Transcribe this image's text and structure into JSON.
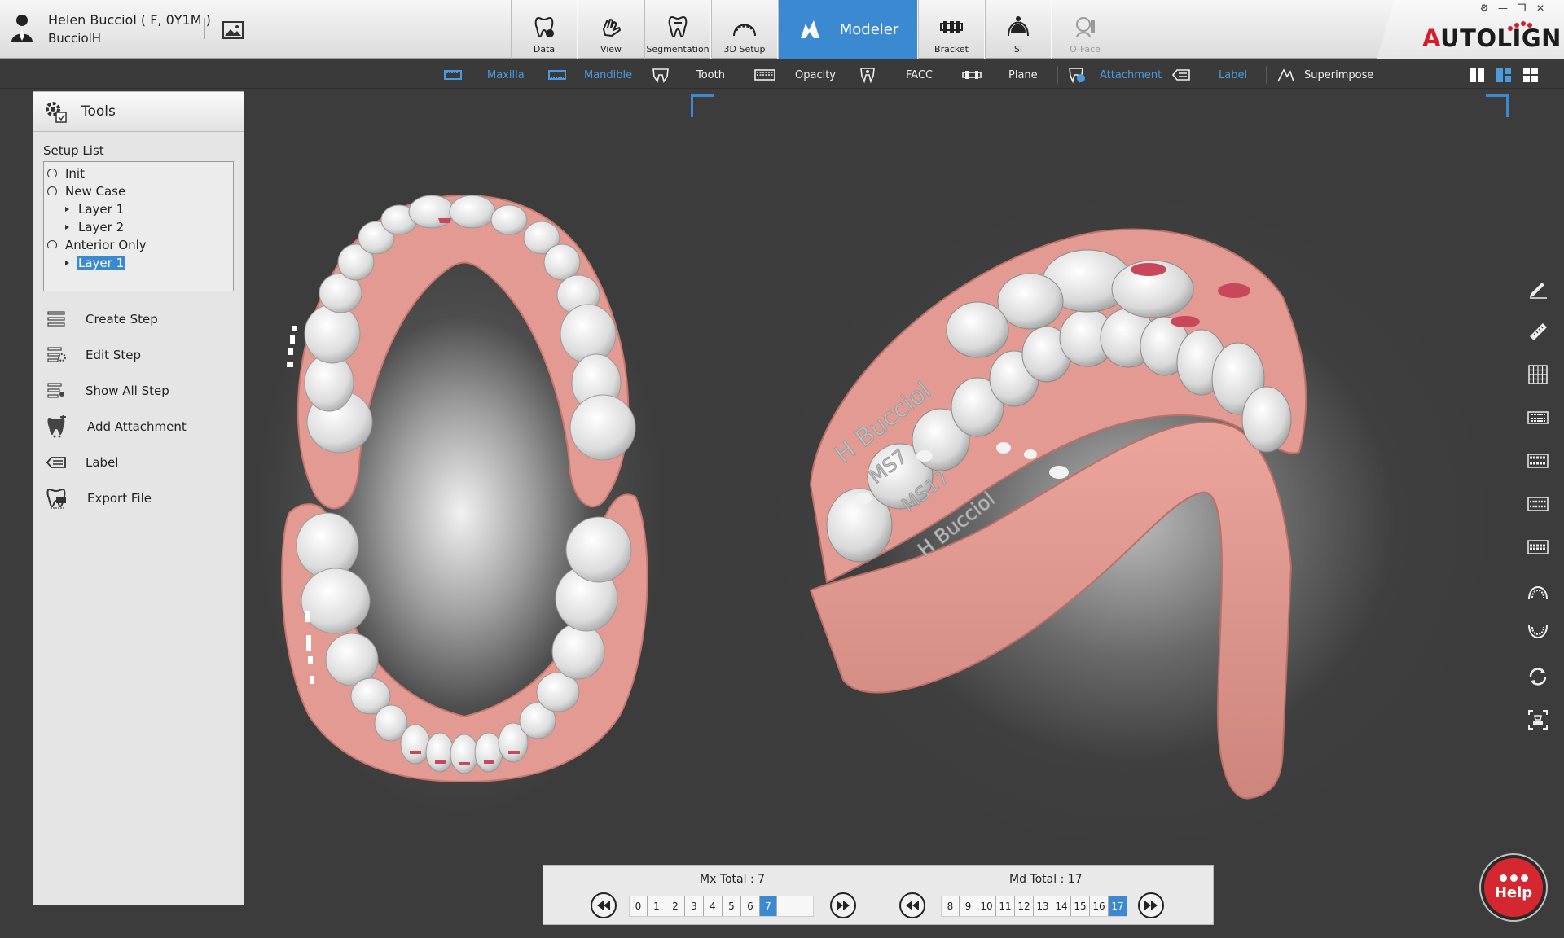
{
  "patient": {
    "name": "Helen Bucciol ( F, 0Y1M )",
    "id": "BucciolH"
  },
  "main_tabs": [
    {
      "label": "Data",
      "icon": "tooth-data-icon"
    },
    {
      "label": "View",
      "icon": "hand-view-icon"
    },
    {
      "label": "Segmentation",
      "icon": "tooth-segment-icon"
    },
    {
      "label": "3D Setup",
      "icon": "arch-setup-icon"
    },
    {
      "label": "Modeler",
      "icon": "modeler-icon",
      "active": true
    },
    {
      "label": "Bracket",
      "icon": "bracket-icon"
    },
    {
      "label": "SI",
      "icon": "si-icon"
    },
    {
      "label": "O-Face",
      "icon": "face-icon",
      "disabled": true
    }
  ],
  "brand": {
    "prefix": "A",
    "rest": "UTOLIGN"
  },
  "subtoolbar": {
    "maxilla": "Maxilla",
    "mandible": "Mandible",
    "tooth": "Tooth",
    "opacity": "Opacity",
    "facc": "FACC",
    "plane": "Plane",
    "attachment": "Attachment",
    "label": "Label",
    "superimpose": "Superimpose"
  },
  "tools": {
    "title": "Tools",
    "setup_list_label": "Setup List",
    "setup_list": [
      {
        "label": "Init",
        "level": 0
      },
      {
        "label": "New Case",
        "level": 0
      },
      {
        "label": "Layer 1",
        "level": 1
      },
      {
        "label": "Layer 2",
        "level": 1
      },
      {
        "label": "Anterior Only",
        "level": 0
      },
      {
        "label": "Layer 1",
        "level": 1,
        "selected": true
      }
    ],
    "items": [
      {
        "label": "Create Step",
        "icon": "create-step-icon"
      },
      {
        "label": "Edit Step",
        "icon": "edit-step-icon"
      },
      {
        "label": "Show All Step",
        "icon": "show-all-step-icon"
      },
      {
        "label": "Add Attachment",
        "icon": "add-attachment-icon"
      },
      {
        "label": "Label",
        "icon": "label-icon"
      },
      {
        "label": "Export File",
        "icon": "export-file-icon"
      }
    ]
  },
  "model_labels": {
    "upper_name": "H Bucciol",
    "upper_code": "MS7",
    "lower_code": "MS17",
    "lower_name": "H Bucciol"
  },
  "steps": {
    "mx_total": "Mx Total : 7",
    "md_total": "Md Total : 17",
    "mx_steps": [
      "0",
      "1",
      "2",
      "3",
      "4",
      "5",
      "6",
      "7"
    ],
    "md_steps": [
      "8",
      "9",
      "10",
      "11",
      "12",
      "13",
      "14",
      "15",
      "16",
      "17"
    ],
    "mx_current": "7",
    "md_current": "17"
  },
  "help": {
    "label": "Help"
  },
  "colors": {
    "accent": "#3b89d1",
    "gum": "#e39a92",
    "tooth": "#e9e9e9",
    "help": "#d4272f"
  }
}
